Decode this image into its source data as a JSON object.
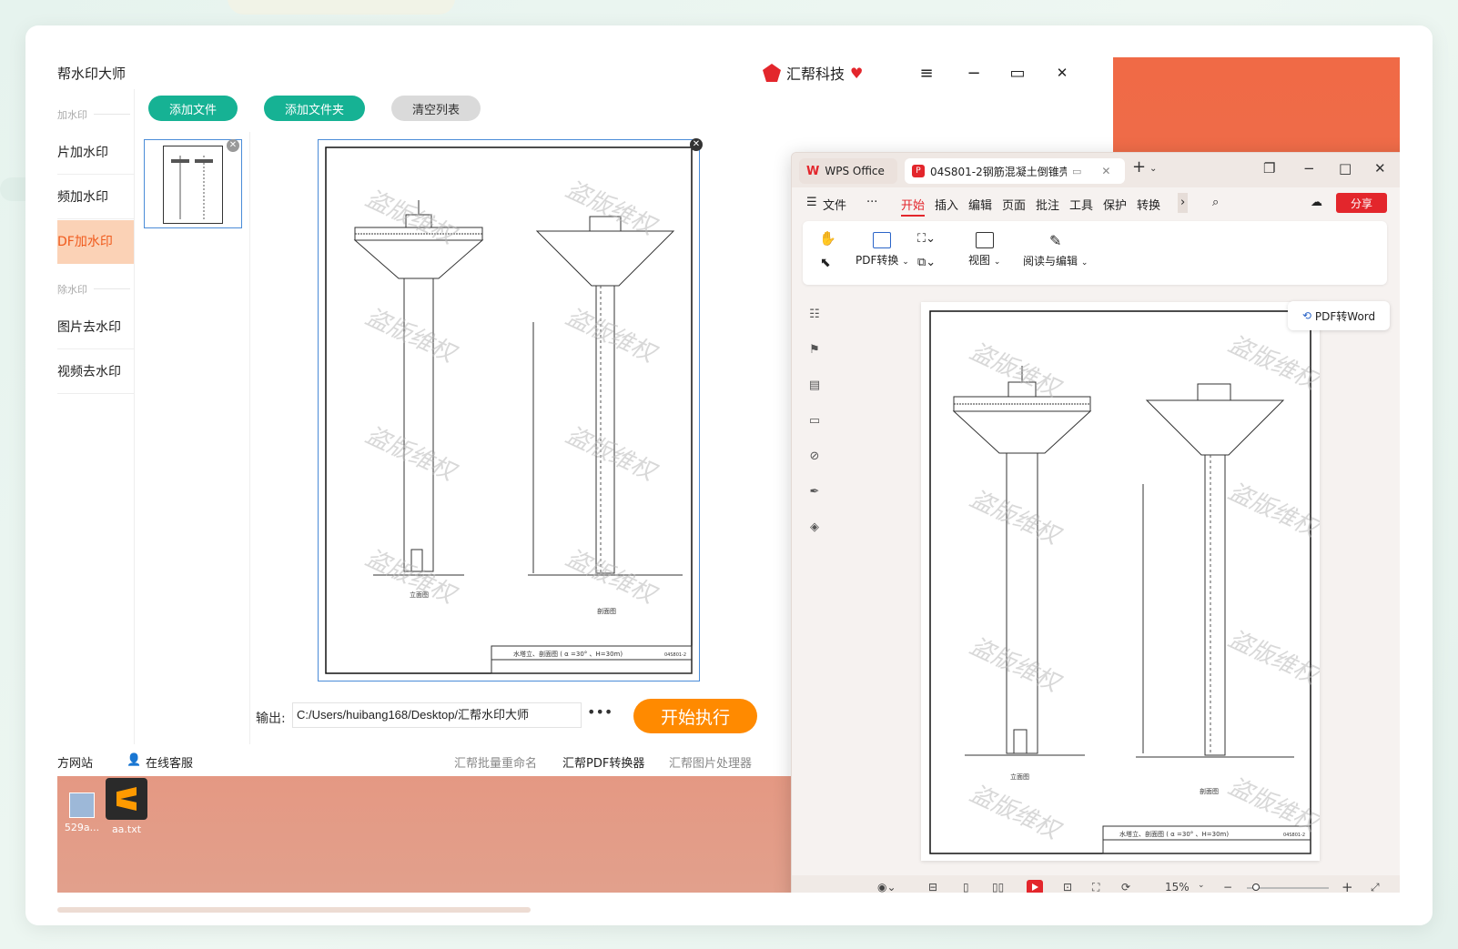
{
  "watermark_app": {
    "title": "帮水印大师",
    "brand": "汇帮科技",
    "window_controls": {
      "menu": "≡",
      "minimize": "−",
      "maximize": "▭",
      "close": "✕"
    },
    "sidebar": {
      "section1": "加水印",
      "items": [
        {
          "label": "片加水印"
        },
        {
          "label": "频加水印"
        },
        {
          "label": "DF加水印",
          "active": true
        }
      ],
      "section2": "除水印",
      "items2": [
        {
          "label": "图片去水印"
        },
        {
          "label": "视频去水印"
        }
      ]
    },
    "toolbar": {
      "add_file": "添加文件",
      "add_folder": "添加文件夹",
      "clear_list": "清空列表"
    },
    "output": {
      "label": "输出:",
      "path": "C:/Users/huibang168/Desktop/汇帮水印大师",
      "more": "•••"
    },
    "start_button": "开始执行",
    "footer": {
      "website": "方网站",
      "support": "在线客服",
      "link1": "汇帮批量重命名",
      "link2": "汇帮PDF转换器",
      "link3": "汇帮图片处理器"
    },
    "preview_watermark_text": "盗版维权"
  },
  "desktop_icons": [
    {
      "label": "529a..."
    },
    {
      "label": "aa.txt"
    }
  ],
  "wps": {
    "tab_home": "WPS Office",
    "tab_doc": "04S801-2钢筋混凝土倒锥壳",
    "menu": {
      "file": "文件",
      "more": "···",
      "items": [
        "开始",
        "插入",
        "编辑",
        "页面",
        "批注",
        "工具",
        "保护",
        "转换"
      ],
      "share": "分享"
    },
    "ribbon": {
      "pdf_convert": "PDF转换",
      "view": "视图",
      "read_edit": "阅读与编辑"
    },
    "pdf_to_word": "PDF转Word",
    "doc_watermark": "盗版维权",
    "status": {
      "zoom": "15%"
    },
    "drawing": {
      "front_label": "立面图",
      "section_label": "剖面图",
      "title_block": "水塔立、剖面图 ( α =30° 、H=30m)",
      "code": "04S801-2"
    }
  },
  "colors": {
    "accent_green": "#16b294",
    "accent_orange": "#ff8a00",
    "wps_red": "#e3262c",
    "wallpaper": "#f06a46"
  }
}
